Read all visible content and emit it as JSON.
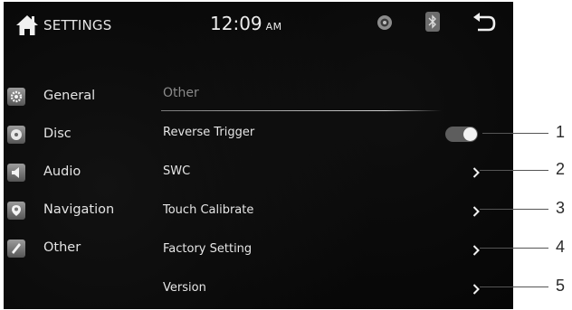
{
  "status_bar": {
    "title": "SETTINGS",
    "time": "12:09",
    "ampm": "AM",
    "icons": [
      "home-icon",
      "disc-status-icon",
      "bluetooth-icon",
      "back-icon"
    ]
  },
  "sidebar": {
    "items": [
      {
        "label": "General",
        "icon": "gear-icon"
      },
      {
        "label": "Disc",
        "icon": "disc-icon"
      },
      {
        "label": "Audio",
        "icon": "speaker-icon"
      },
      {
        "label": "Navigation",
        "icon": "map-pin-icon"
      },
      {
        "label": "Other",
        "icon": "wrench-icon"
      }
    ]
  },
  "main": {
    "section_title": "Other",
    "rows": [
      {
        "label": "Reverse Trigger",
        "control": "toggle",
        "toggle_on": true
      },
      {
        "label": "SWC",
        "control": "chevron"
      },
      {
        "label": "Touch Calibrate",
        "control": "chevron"
      },
      {
        "label": "Factory Setting",
        "control": "chevron"
      },
      {
        "label": "Version",
        "control": "chevron"
      }
    ]
  },
  "callouts": [
    "1",
    "2",
    "3",
    "4",
    "5"
  ],
  "colors": {
    "screen_bg": "#060606",
    "text": "#e6e6e6",
    "section_title": "#8a8a8a",
    "icon_tile": "#8a8a8a"
  }
}
